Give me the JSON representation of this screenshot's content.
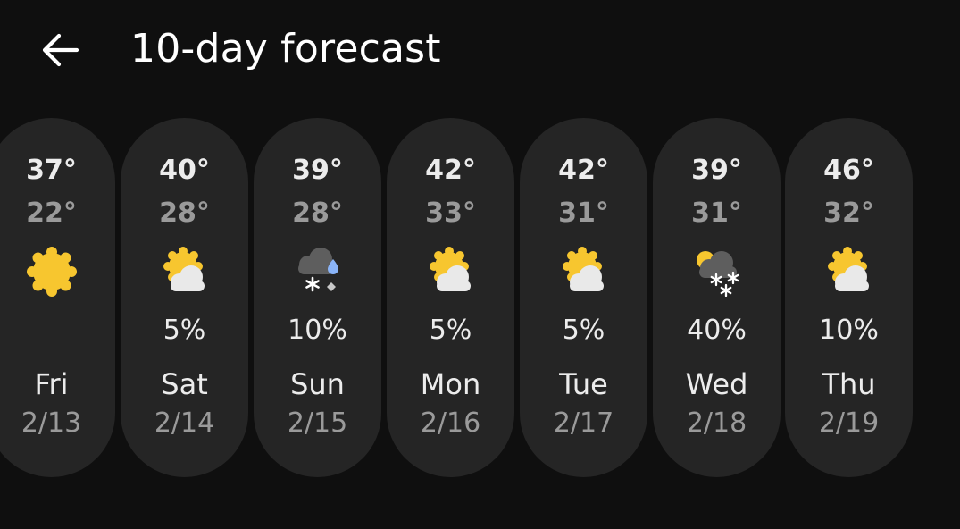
{
  "header": {
    "back_icon": "arrow-left-icon",
    "title": "10-day forecast"
  },
  "days": [
    {
      "high": "37°",
      "low": "22°",
      "icon": "sunny-icon",
      "precip": "",
      "day": "Fri",
      "date": "2/13"
    },
    {
      "high": "40°",
      "low": "28°",
      "icon": "partly-cloudy-icon",
      "precip": "5%",
      "day": "Sat",
      "date": "2/14"
    },
    {
      "high": "39°",
      "low": "28°",
      "icon": "mixed-rain-snow-icon",
      "precip": "10%",
      "day": "Sun",
      "date": "2/15"
    },
    {
      "high": "42°",
      "low": "33°",
      "icon": "partly-cloudy-icon",
      "precip": "5%",
      "day": "Mon",
      "date": "2/16"
    },
    {
      "high": "42°",
      "low": "31°",
      "icon": "partly-cloudy-icon",
      "precip": "5%",
      "day": "Tue",
      "date": "2/17"
    },
    {
      "high": "39°",
      "low": "31°",
      "icon": "snow-showers-icon",
      "precip": "40%",
      "day": "Wed",
      "date": "2/18"
    },
    {
      "high": "46°",
      "low": "32°",
      "icon": "partly-cloudy-icon",
      "precip": "10%",
      "day": "Thu",
      "date": "2/19"
    }
  ],
  "colors": {
    "background": "#0f0f0f",
    "card": "#252525",
    "text_primary": "#ececec",
    "text_secondary": "#9a9a9a",
    "sun": "#f7c62f",
    "cloud": "#e6e6e6",
    "storm_cloud": "#5e5e5e",
    "rain": "#8ab4f8"
  }
}
